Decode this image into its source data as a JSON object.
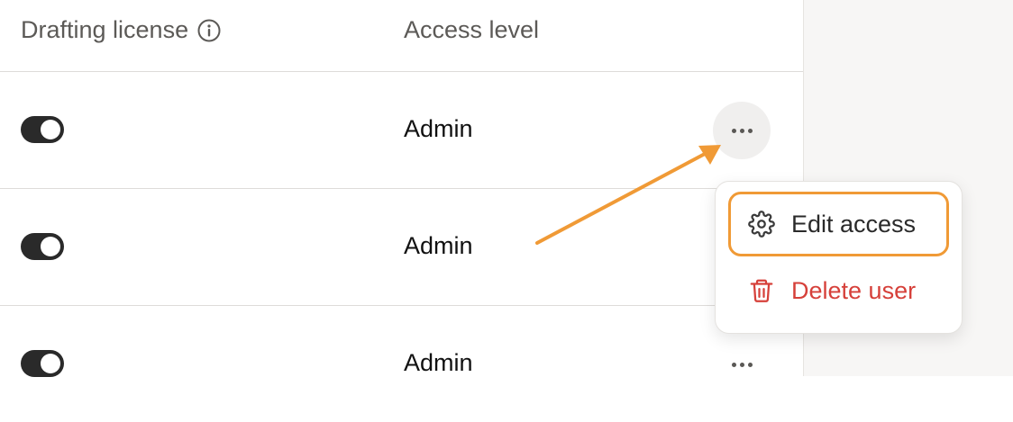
{
  "table": {
    "columns": {
      "drafting_license": "Drafting license",
      "access_level": "Access level"
    },
    "rows": [
      {
        "license_enabled": true,
        "access_level": "Admin"
      },
      {
        "license_enabled": true,
        "access_level": "Admin"
      },
      {
        "license_enabled": true,
        "access_level": "Admin"
      }
    ]
  },
  "menu": {
    "edit_label": "Edit access",
    "delete_label": "Delete user"
  },
  "icons": {
    "info": "info-icon",
    "more": "more-horizontal-icon",
    "edit": "gear-icon",
    "delete": "trash-icon"
  },
  "colors": {
    "highlight": "#f09a36",
    "danger": "#d6403a",
    "toggle_on": "#2a2a2a"
  }
}
